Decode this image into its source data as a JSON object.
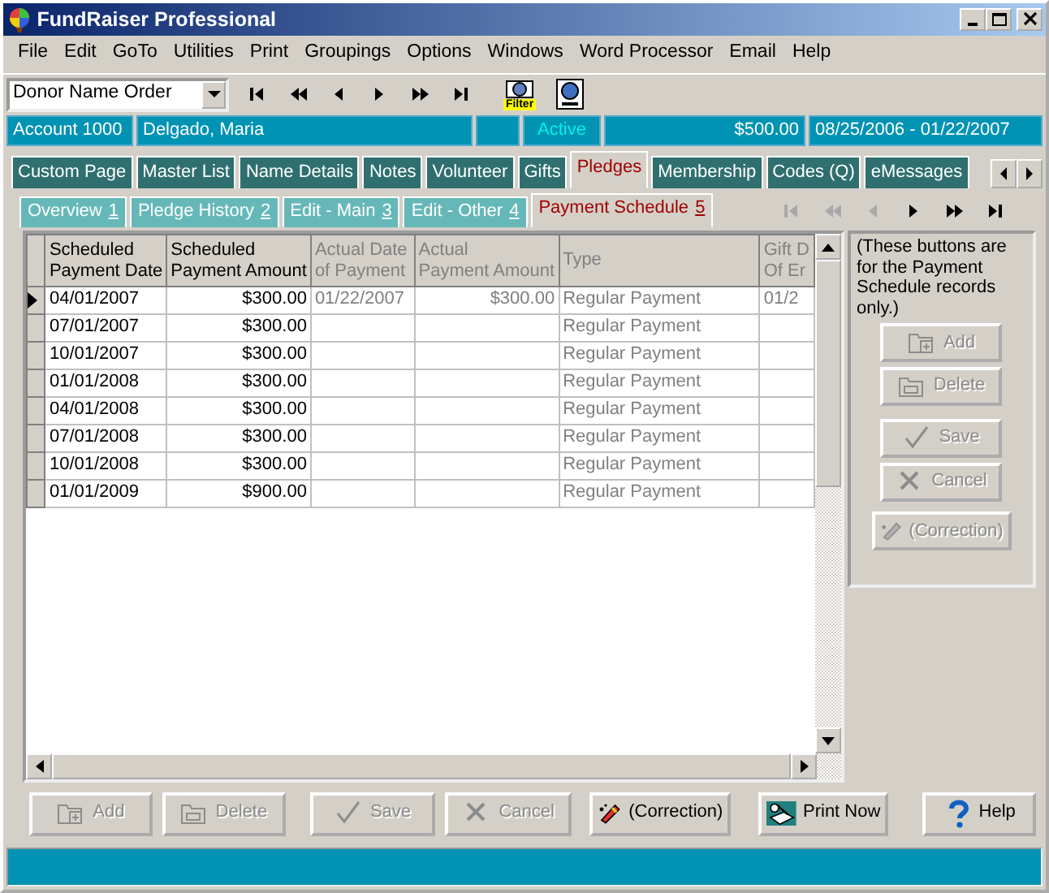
{
  "window": {
    "title": "FundRaiser Professional"
  },
  "menu": [
    "File",
    "Edit",
    "GoTo",
    "Utilities",
    "Print",
    "Groupings",
    "Options",
    "Windows",
    "Word Processor",
    "Email",
    "Help"
  ],
  "toolbar": {
    "sort_order": "Donor Name Order",
    "record_nav": [
      {
        "kind": "first",
        "disabled": false
      },
      {
        "kind": "rewind",
        "disabled": false
      },
      {
        "kind": "prev",
        "disabled": false
      },
      {
        "kind": "next",
        "disabled": false
      },
      {
        "kind": "forward",
        "disabled": false
      },
      {
        "kind": "last",
        "disabled": false
      }
    ],
    "tools": [
      {
        "kind": "filter",
        "label": "Filter"
      },
      {
        "kind": "find"
      }
    ]
  },
  "info_bar": {
    "account": "Account 1000",
    "name": "Delgado, Maria",
    "status": "Active",
    "amount": "$500.00",
    "dates": "08/25/2006 - 01/22/2007"
  },
  "tabs": [
    {
      "label": "Custom Page",
      "selected": false
    },
    {
      "label": "Master List",
      "selected": false
    },
    {
      "label": "Name Details",
      "selected": false
    },
    {
      "label": "Notes",
      "selected": false
    },
    {
      "label": "Volunteer",
      "selected": false
    },
    {
      "label": "Gifts",
      "selected": false
    },
    {
      "label": "Pledges",
      "selected": true
    },
    {
      "label": "Membership",
      "selected": false
    },
    {
      "label": "Codes (Q)",
      "selected": false
    },
    {
      "label": "eMessages",
      "selected": false
    }
  ],
  "subtabs": [
    {
      "label": "Overview",
      "number": "1",
      "selected": false
    },
    {
      "label": "Pledge History",
      "number": "2",
      "selected": false
    },
    {
      "label": "Edit - Main",
      "number": "3",
      "selected": false
    },
    {
      "label": "Edit - Other",
      "number": "4",
      "selected": false
    },
    {
      "label": "Payment Schedule",
      "number": "5",
      "selected": true
    }
  ],
  "subtab_nav": [
    {
      "kind": "first",
      "disabled": true
    },
    {
      "kind": "rewind",
      "disabled": true
    },
    {
      "kind": "prev",
      "disabled": true
    },
    {
      "kind": "next",
      "disabled": false
    },
    {
      "kind": "forward",
      "disabled": false
    },
    {
      "kind": "last",
      "disabled": false
    }
  ],
  "table": {
    "columns": [
      {
        "label": [
          "Scheduled",
          "Payment Date"
        ],
        "readonly": false
      },
      {
        "label": [
          "Scheduled",
          "Payment Amount"
        ],
        "readonly": false
      },
      {
        "label": [
          "Actual Date",
          "of Payment"
        ],
        "readonly": true
      },
      {
        "label": [
          "Actual",
          "Payment Amount"
        ],
        "readonly": true
      },
      {
        "label": [
          "Type"
        ],
        "readonly": true
      },
      {
        "label": [
          "Gift D",
          "Of Er"
        ],
        "readonly": true
      }
    ],
    "rows": [
      {
        "selected": true,
        "cells": [
          "04/01/2007",
          "$300.00",
          "01/22/2007",
          "$300.00",
          "Regular Payment",
          "01/2"
        ]
      },
      {
        "selected": false,
        "cells": [
          "07/01/2007",
          "$300.00",
          "",
          "",
          "Regular Payment",
          ""
        ]
      },
      {
        "selected": false,
        "cells": [
          "10/01/2007",
          "$300.00",
          "",
          "",
          "Regular Payment",
          ""
        ]
      },
      {
        "selected": false,
        "cells": [
          "01/01/2008",
          "$300.00",
          "",
          "",
          "Regular Payment",
          ""
        ]
      },
      {
        "selected": false,
        "cells": [
          "04/01/2008",
          "$300.00",
          "",
          "",
          "Regular Payment",
          ""
        ]
      },
      {
        "selected": false,
        "cells": [
          "07/01/2008",
          "$300.00",
          "",
          "",
          "Regular Payment",
          ""
        ]
      },
      {
        "selected": false,
        "cells": [
          "10/01/2008",
          "$300.00",
          "",
          "",
          "Regular Payment",
          ""
        ]
      },
      {
        "selected": false,
        "cells": [
          "01/01/2009",
          "$900.00",
          "",
          "",
          "Regular Payment",
          ""
        ]
      }
    ]
  },
  "side_panel": {
    "note": "(These buttons are for the Payment Schedule records only.)",
    "buttons": [
      {
        "kind": "add",
        "label": "Add",
        "disabled": true
      },
      {
        "kind": "delete",
        "label": "Delete",
        "disabled": true
      },
      {
        "kind": "save",
        "label": "Save",
        "disabled": true
      },
      {
        "kind": "cancel",
        "label": "Cancel",
        "disabled": true
      },
      {
        "kind": "correction",
        "label": "(Correction)",
        "disabled": true
      }
    ]
  },
  "bottom_buttons": [
    {
      "kind": "add",
      "label": "Add",
      "disabled": true
    },
    {
      "kind": "delete",
      "label": "Delete",
      "disabled": true
    },
    {
      "kind": "save",
      "label": "Save",
      "disabled": true
    },
    {
      "kind": "cancel",
      "label": "Cancel",
      "disabled": true
    },
    {
      "kind": "correction",
      "label": "(Correction)",
      "disabled": false
    },
    {
      "kind": "print",
      "label": "Print Now",
      "disabled": false
    },
    {
      "kind": "help",
      "label": "Help",
      "disabled": false
    }
  ]
}
